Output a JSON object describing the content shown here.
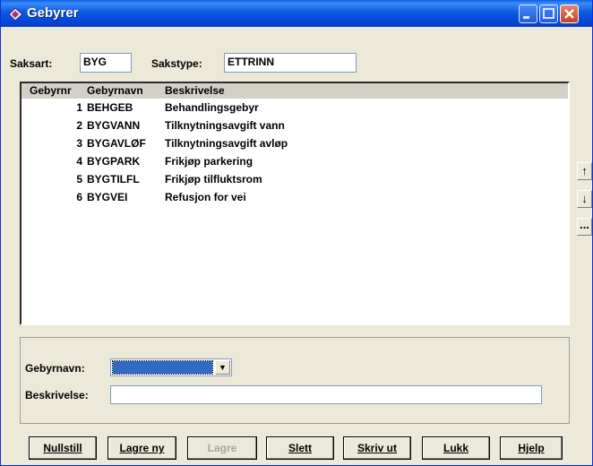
{
  "window": {
    "title": "Gebyrer"
  },
  "header": {
    "saksart_label": "Saksart:",
    "saksart_value": "BYG",
    "sakstype_label": "Sakstype:",
    "sakstype_value": "ETTRINN"
  },
  "list": {
    "columns": [
      "Gebyrnr",
      "Gebyrnavn",
      "Beskrivelse"
    ],
    "rows": [
      {
        "nr": "1",
        "navn": "BEHGEB",
        "beskrivelse": "Behandlingsgebyr"
      },
      {
        "nr": "2",
        "navn": "BYGVANN",
        "beskrivelse": "Tilknytningsavgift vann"
      },
      {
        "nr": "3",
        "navn": "BYGAVLØF",
        "beskrivelse": "Tilknytningsavgift avløp"
      },
      {
        "nr": "4",
        "navn": "BYGPARK",
        "beskrivelse": "Frikjøp parkering"
      },
      {
        "nr": "5",
        "navn": "BYGTILFL",
        "beskrivelse": "Frikjøp tilfluktsrom"
      },
      {
        "nr": "6",
        "navn": "BYGVEI",
        "beskrivelse": "Refusjon for vei"
      }
    ]
  },
  "side_buttons": {
    "up": "↑",
    "down": "↓",
    "more": "..."
  },
  "form": {
    "gebyrnavn_label": "Gebyrnavn:",
    "gebyrnavn_value": "",
    "beskrivelse_label": "Beskrivelse:",
    "beskrivelse_value": ""
  },
  "buttons": {
    "nullstill": "Nullstill",
    "lagre_ny": "Lagre ny",
    "lagre": "Lagre",
    "slett": "Slett",
    "skriv_ut": "Skriv ut",
    "lukk": "Lukk",
    "hjelp": "Hjelp"
  },
  "colors": {
    "titlebar": "#0a5fe8",
    "selection": "#316ac5",
    "face": "#ece9d8"
  }
}
